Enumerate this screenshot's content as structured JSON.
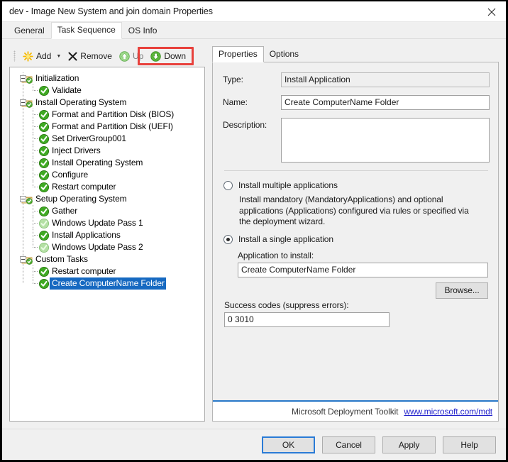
{
  "window": {
    "title": "dev - Image New System and join domain Properties",
    "close_icon": "close-icon"
  },
  "tabs": [
    {
      "label": "General",
      "active": false
    },
    {
      "label": "Task Sequence",
      "active": true
    },
    {
      "label": "OS Info",
      "active": false
    }
  ],
  "toolbar": {
    "add_label": "Add",
    "add_caret": "▼",
    "remove_label": "Remove",
    "up_label": "Up",
    "down_label": "Down",
    "highlight_color": "#e8413c"
  },
  "tree": {
    "selected": "Create ComputerName Folder",
    "nodes": [
      {
        "label": "Initialization",
        "type": "group",
        "depth": 0,
        "last": false
      },
      {
        "label": "Validate",
        "type": "task",
        "depth": 1,
        "last": true
      },
      {
        "label": "Install Operating System",
        "type": "group",
        "depth": 0,
        "last": false
      },
      {
        "label": "Format and Partition Disk (BIOS)",
        "type": "task",
        "depth": 1,
        "last": false
      },
      {
        "label": "Format and Partition Disk (UEFI)",
        "type": "task",
        "depth": 1,
        "last": false
      },
      {
        "label": "Set DriverGroup001",
        "type": "task",
        "depth": 1,
        "last": false
      },
      {
        "label": "Inject Drivers",
        "type": "task",
        "depth": 1,
        "last": false
      },
      {
        "label": "Install Operating System",
        "type": "task",
        "depth": 1,
        "last": false
      },
      {
        "label": "Configure",
        "type": "task",
        "depth": 1,
        "last": false
      },
      {
        "label": "Restart computer",
        "type": "task",
        "depth": 1,
        "last": true
      },
      {
        "label": "Setup Operating System",
        "type": "group",
        "depth": 0,
        "last": false
      },
      {
        "label": "Gather",
        "type": "task",
        "depth": 1,
        "last": false
      },
      {
        "label": "Windows Update Pass 1",
        "type": "task-disabled",
        "depth": 1,
        "last": false
      },
      {
        "label": "Install Applications",
        "type": "task",
        "depth": 1,
        "last": false
      },
      {
        "label": "Windows Update Pass 2",
        "type": "task-disabled",
        "depth": 1,
        "last": true
      },
      {
        "label": "Custom Tasks",
        "type": "group",
        "depth": 0,
        "last": true
      },
      {
        "label": "Restart computer",
        "type": "task",
        "depth": 1,
        "last": false
      },
      {
        "label": "Create ComputerName Folder",
        "type": "task",
        "depth": 1,
        "last": true,
        "selected": true
      }
    ]
  },
  "details": {
    "tabs": [
      {
        "label": "Properties",
        "active": true
      },
      {
        "label": "Options",
        "active": false
      }
    ],
    "type_label": "Type:",
    "type_value": "Install Application",
    "name_label": "Name:",
    "name_value": "Create ComputerName Folder",
    "description_label": "Description:",
    "description_value": "",
    "radio_multiple_label": "Install multiple applications",
    "radio_multiple_desc": "Install mandatory (MandatoryApplications) and optional applications (Applications) configured via rules or specified via the deployment wizard.",
    "radio_single_label": "Install a single application",
    "app_to_install_label": "Application to install:",
    "app_to_install_value": "Create ComputerName Folder",
    "browse_label": "Browse...",
    "success_codes_label": "Success codes (suppress errors):",
    "success_codes_value": "0 3010",
    "footer_text": "Microsoft Deployment Toolkit",
    "footer_link": "www.microsoft.com/mdt",
    "footer_accent": "#2878c8"
  },
  "dialog_buttons": [
    {
      "label": "OK",
      "focused": true
    },
    {
      "label": "Cancel",
      "focused": false
    },
    {
      "label": "Apply",
      "focused": false
    },
    {
      "label": "Help",
      "focused": false
    }
  ]
}
